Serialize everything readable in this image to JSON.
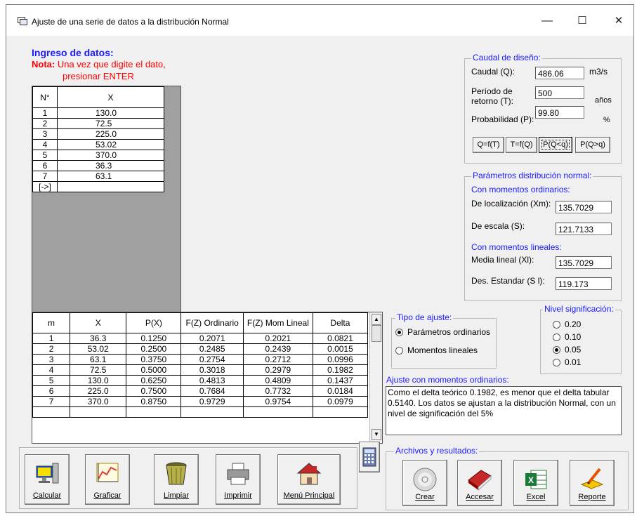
{
  "window": {
    "title": "Ajuste de una serie de datos a la distribución Normal",
    "minimize": "—",
    "maximize": "☐",
    "close": "✕"
  },
  "ingreso": {
    "heading": "Ingreso de datos:",
    "nota_label": "Nota:",
    "nota_text": " Una vez que digite el dato,",
    "nota_text2": "presionar ENTER"
  },
  "data_grid": {
    "headers": [
      "N°",
      "X"
    ],
    "rows": [
      [
        "1",
        "130.0"
      ],
      [
        "2",
        "72.5"
      ],
      [
        "3",
        "225.0"
      ],
      [
        "4",
        "53.02"
      ],
      [
        "5",
        "370.0"
      ],
      [
        "6",
        "36.3"
      ],
      [
        "7",
        "63.1"
      ]
    ],
    "new_row_marker": "[->]"
  },
  "results_grid": {
    "headers": [
      "m",
      "X",
      "P(X)",
      "F(Z) Ordinario",
      "F(Z) Mom Lineal",
      "Delta"
    ],
    "rows": [
      [
        "1",
        "36.3",
        "0.1250",
        "0.2071",
        "0.2021",
        "0.0821"
      ],
      [
        "2",
        "53.02",
        "0.2500",
        "0.2485",
        "0.2439",
        "0.0015"
      ],
      [
        "3",
        "63.1",
        "0.3750",
        "0.2754",
        "0.2712",
        "0.0996"
      ],
      [
        "4",
        "72.5",
        "0.5000",
        "0.3018",
        "0.2979",
        "0.1982"
      ],
      [
        "5",
        "130.0",
        "0.6250",
        "0.4813",
        "0.4809",
        "0.1437"
      ],
      [
        "6",
        "225.0",
        "0.7500",
        "0.7684",
        "0.7732",
        "0.0184"
      ],
      [
        "7",
        "370.0",
        "0.8750",
        "0.9729",
        "0.9754",
        "0.0979"
      ]
    ]
  },
  "caudal": {
    "legend": "Caudal de diseño:",
    "q_label": "Caudal (Q):",
    "q_value": "486.06",
    "q_unit": "m3/s",
    "t_label1": "Período de",
    "t_label2": "retorno (T):",
    "t_value": "500",
    "t_unit": "años",
    "p_label": "Probabilidad (P):",
    "p_value": "99.80",
    "p_unit": "%",
    "buttons": [
      "Q=f(T)",
      "T=f(Q)",
      "P(Q<q)",
      "P(Q>q)"
    ]
  },
  "parametros": {
    "legend": "Parámetros distribución normal:",
    "ord_heading": "Con momentos ordinarios:",
    "loc_label": "De localización (Xm):",
    "loc_value": "135.7029",
    "esc_label": "De escala (S):",
    "esc_value": "121.7133",
    "lin_heading": "Con momentos lineales:",
    "media_label": "Media  lineal (Xl):",
    "media_value": "135.7029",
    "des_label": "Des. Estandar (S l):",
    "des_value": "119.173"
  },
  "tipo_ajuste": {
    "legend": "Tipo de ajuste:",
    "opt1": "Parámetros ordinarios",
    "opt2": "Momentos lineales",
    "selected": "opt1"
  },
  "nivel": {
    "legend": "Nivel significación:",
    "options": [
      "0.20",
      "0.10",
      "0.05",
      "0.01"
    ],
    "selected": "0.05"
  },
  "ajuste": {
    "heading": "Ajuste con momentos ordinarios:",
    "text": "Como el delta teórico 0.1982, es menor que el delta tabular 0.5140. Los datos se ajustan a la distribución Normal, con un nivel de significación del 5%"
  },
  "archivos": {
    "legend": "Archivos y resultados:"
  },
  "toolbar_left": [
    "Calcular",
    "Graficar",
    "Limpiar",
    "Imprimir",
    "Menú Principal"
  ],
  "toolbar_right": [
    "Crear",
    "Accesar",
    "Excel",
    "Reporte"
  ],
  "colors": {
    "accent_blue": "#1a1aff",
    "note_red": "#ff0000",
    "window_bg": "#f0f0f0"
  }
}
